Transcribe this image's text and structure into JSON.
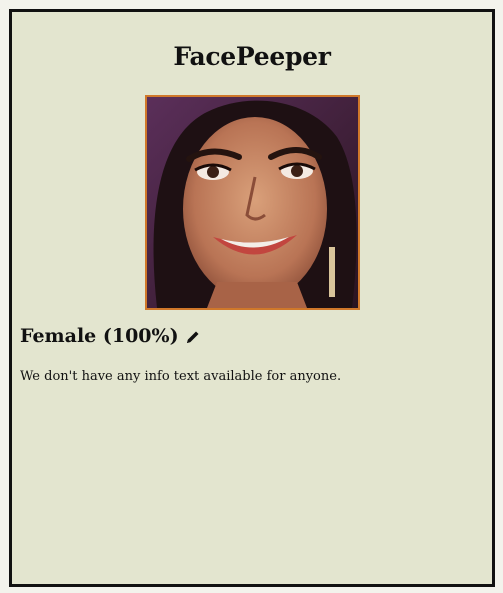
{
  "app": {
    "title": "FacePeeper"
  },
  "prediction": {
    "label": "Female (100%)",
    "edit_icon": "pencil-icon"
  },
  "info": {
    "text": "We don't have any info text available for anyone."
  },
  "colors": {
    "background": "#e3e5cf",
    "frame_border": "#111111",
    "photo_border": "#d0782a"
  }
}
